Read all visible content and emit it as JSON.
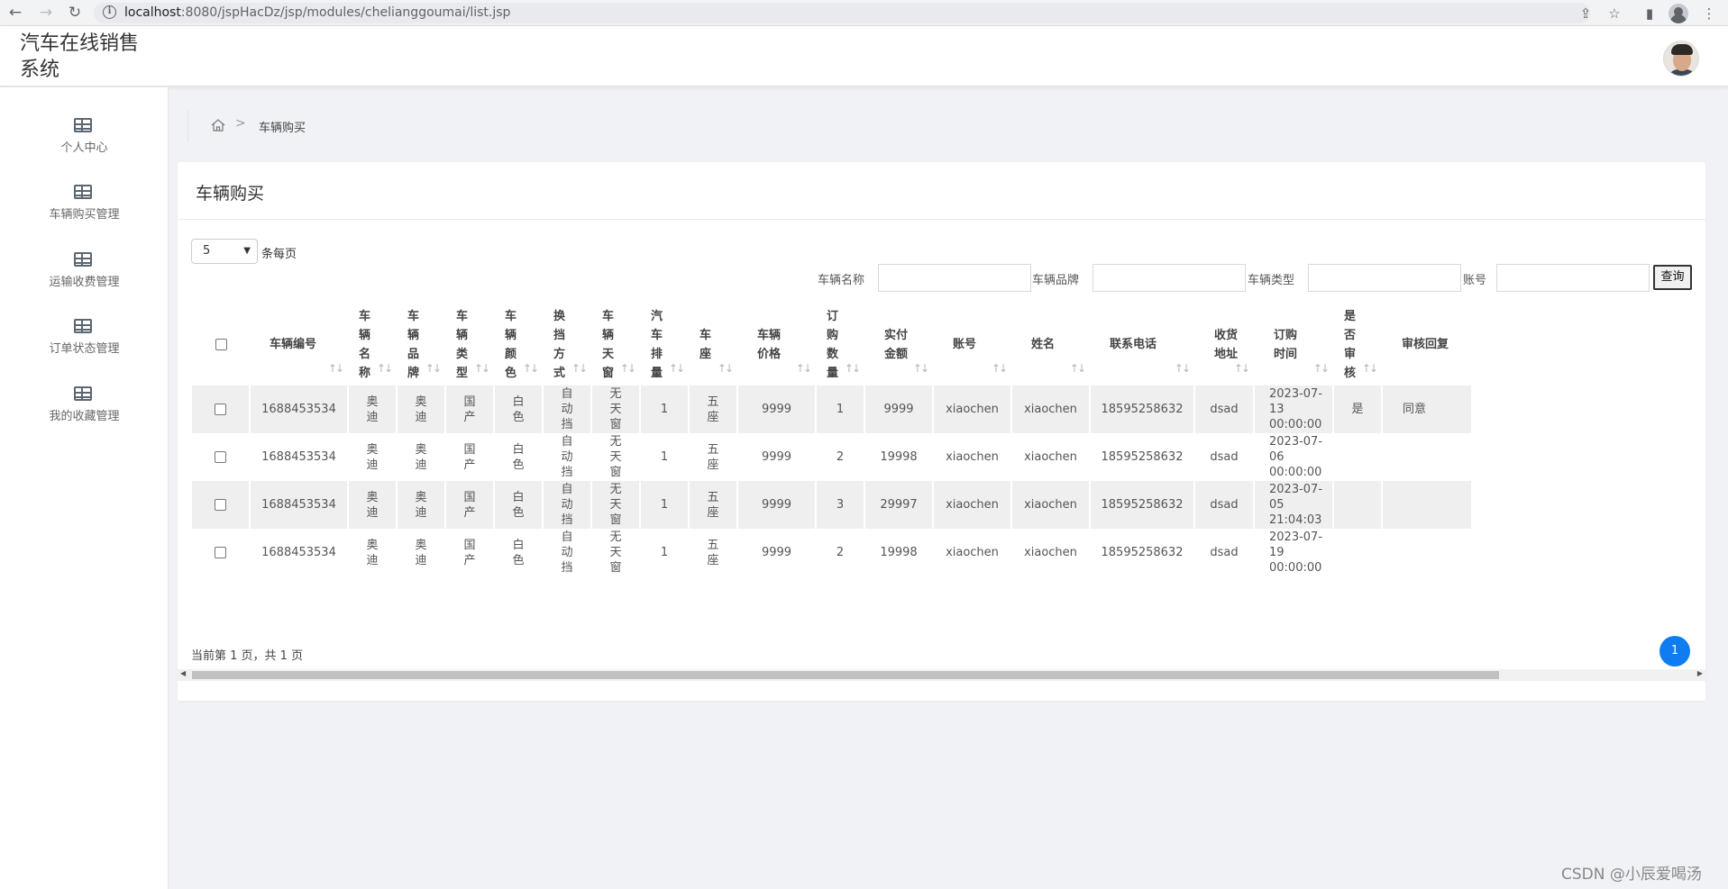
{
  "browser": {
    "url_host": "localhost",
    "url_rest": ":8080/jspHacDz/jsp/modules/chelianggoumai/list.jsp",
    "back_icon": "←",
    "forward_icon": "→",
    "reload_icon": "↻"
  },
  "header": {
    "title_line1": "汽车在线销售",
    "title_line2": "系统"
  },
  "sidebar": {
    "items": [
      {
        "label": "个人中心",
        "icon": "table-icon"
      },
      {
        "label": "车辆购买管理",
        "icon": "table-icon"
      },
      {
        "label": "运输收费管理",
        "icon": "table-icon"
      },
      {
        "label": "订单状态管理",
        "icon": "table-icon"
      },
      {
        "label": "我的收藏管理",
        "icon": "table-icon"
      }
    ]
  },
  "breadcrumb": {
    "separator": ">",
    "current": "车辆购买"
  },
  "card": {
    "title": "车辆购买"
  },
  "pagination": {
    "page_size": "5",
    "page_size_label": "条每页",
    "info": "当前第 1 页，共 1 页",
    "current_page": "1"
  },
  "search": {
    "fields": [
      {
        "label": "车辆名称",
        "value": ""
      },
      {
        "label": "车辆品牌",
        "value": ""
      },
      {
        "label": "车辆类型",
        "value": ""
      },
      {
        "label": "账号",
        "value": ""
      }
    ],
    "button_label": "查询"
  },
  "table": {
    "columns": [
      "车辆编号",
      "车辆名称",
      "车辆品牌",
      "车辆类型",
      "车辆颜色",
      "换挡方式",
      "车辆天窗",
      "汽车排量",
      "车座",
      "车辆价格",
      "订购数量",
      "实付金额",
      "账号",
      "姓名",
      "联系电话",
      "收货地址",
      "订购时间",
      "是否审核",
      "审核回复"
    ],
    "rows": [
      [
        "1688453534",
        "奥迪",
        "奥迪",
        "国产",
        "白色",
        "自动挡",
        "无天窗",
        "1",
        "五座",
        "9999",
        "1",
        "9999",
        "xiaochen",
        "xiaochen",
        "18595258632",
        "dsad",
        "2023-07-13 00:00:00",
        "是",
        "同意"
      ],
      [
        "1688453534",
        "奥迪",
        "奥迪",
        "国产",
        "白色",
        "自动挡",
        "无天窗",
        "1",
        "五座",
        "9999",
        "2",
        "19998",
        "xiaochen",
        "xiaochen",
        "18595258632",
        "dsad",
        "2023-07-06 00:00:00",
        "",
        ""
      ],
      [
        "1688453534",
        "奥迪",
        "奥迪",
        "国产",
        "白色",
        "自动挡",
        "无天窗",
        "1",
        "五座",
        "9999",
        "3",
        "29997",
        "xiaochen",
        "xiaochen",
        "18595258632",
        "dsad",
        "2023-07-05 21:04:03",
        "",
        ""
      ],
      [
        "1688453534",
        "奥迪",
        "奥迪",
        "国产",
        "白色",
        "自动挡",
        "无天窗",
        "1",
        "五座",
        "9999",
        "2",
        "19998",
        "xiaochen",
        "xiaochen",
        "18595258632",
        "dsad",
        "2023-07-19 00:00:00",
        "",
        ""
      ]
    ]
  },
  "watermark": "CSDN @小辰爱喝汤"
}
